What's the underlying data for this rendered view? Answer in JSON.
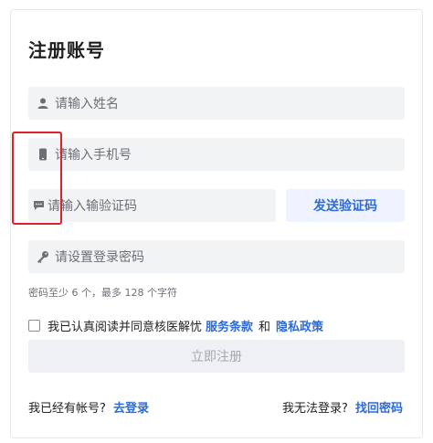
{
  "form": {
    "title": "注册账号",
    "name_placeholder": "请输入姓名",
    "phone_placeholder": "请输入手机号",
    "code_placeholder": "请输入输验证码",
    "send_code_label": "发送验证码",
    "password_placeholder": "请设置登录密码",
    "password_hint": "密码至少 6 个，最多 128 个字符",
    "agree_prefix": "我已认真阅读并同意核医解忧",
    "terms_link": "服务条款",
    "and_text": "和",
    "privacy_link": "隐私政策",
    "submit_label": "立即注册",
    "has_account_text": "我已经有帐号?",
    "login_link": "去登录",
    "cant_login_text": "我无法登录?",
    "recover_link": "找回密码"
  },
  "colors": {
    "link": "#2f6bd7",
    "field_bg": "#f2f3f5",
    "highlight": "#e0202a"
  },
  "icons": {
    "name": "user-icon",
    "phone": "phone-icon",
    "code": "message-icon",
    "password": "key-icon"
  }
}
